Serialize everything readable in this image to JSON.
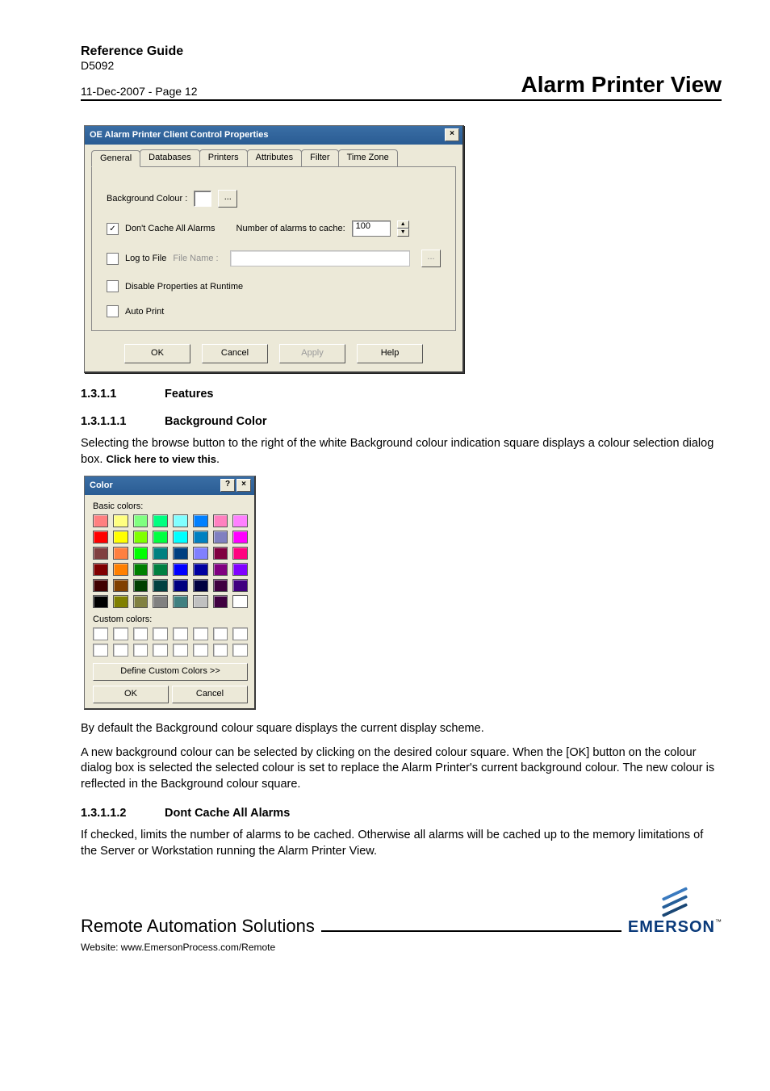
{
  "header": {
    "ref_guide": "Reference Guide",
    "doc_id": "D5092",
    "date_page": "11-Dec-2007 - Page 12",
    "view_title": "Alarm Printer View"
  },
  "dlg": {
    "title": "OE Alarm Printer Client Control Properties",
    "close": "×",
    "tabs": [
      "General",
      "Databases",
      "Printers",
      "Attributes",
      "Filter",
      "Time Zone"
    ],
    "bg_label": "Background Colour :",
    "browse": "...",
    "dont_cache": {
      "checked": true,
      "label": "Don't Cache All Alarms"
    },
    "num_label": "Number of alarms to cache:",
    "num_value": "100",
    "log_file": {
      "checked": false,
      "label": "Log to File",
      "file_label": "File Name :"
    },
    "disable_props": {
      "checked": false,
      "label": "Disable Properties at Runtime"
    },
    "auto_print": {
      "checked": false,
      "label": "Auto Print"
    },
    "buttons": {
      "ok": "OK",
      "cancel": "Cancel",
      "apply": "Apply",
      "help": "Help"
    }
  },
  "sections": {
    "s1_num": "1.3.1.1",
    "s1_title": "Features",
    "s2_num": "1.3.1.1.1",
    "s2_title": "Background Color",
    "s2_text_a": "Selecting the browse button to the right of the white Background colour indication square displays a colour selection dialog box. ",
    "s2_link": "Click here to view this",
    "s2_dot": ".",
    "s2_text_b": "By default the Background colour square displays the current display scheme.",
    "s2_text_c": "A new background colour can be selected by clicking on the desired colour square. When the [OK] button on the colour dialog box is selected the selected colour is set to replace the Alarm Printer's current background colour. The new colour is reflected in the Background colour square.",
    "s3_num": "1.3.1.1.2",
    "s3_title": "Dont Cache All Alarms",
    "s3_text": "If checked, limits the number of alarms to be cached. Otherwise all alarms will be cached up to the memory limitations of the Server or Workstation running the Alarm Printer View."
  },
  "color_dlg": {
    "title": "Color",
    "help": "?",
    "close": "×",
    "basic_label": "Basic colors:",
    "custom_label": "Custom colors:",
    "define": "Define Custom Colors >>",
    "ok": "OK",
    "cancel": "Cancel",
    "basic_colors": [
      [
        "#ff8080",
        "#ffff80",
        "#80ff80",
        "#00ff80",
        "#80ffff",
        "#0080ff",
        "#ff80c0",
        "#ff80ff"
      ],
      [
        "#ff0000",
        "#ffff00",
        "#80ff00",
        "#00ff40",
        "#00ffff",
        "#0080c0",
        "#8080c0",
        "#ff00ff"
      ],
      [
        "#804040",
        "#ff8040",
        "#00ff00",
        "#008080",
        "#004080",
        "#8080ff",
        "#800040",
        "#ff0080"
      ],
      [
        "#800000",
        "#ff8000",
        "#008000",
        "#008040",
        "#0000ff",
        "#0000a0",
        "#800080",
        "#8000ff"
      ],
      [
        "#400000",
        "#804000",
        "#004000",
        "#004040",
        "#000080",
        "#000040",
        "#400040",
        "#400080"
      ],
      [
        "#000000",
        "#808000",
        "#808040",
        "#808080",
        "#408080",
        "#c0c0c0",
        "#400040",
        "#ffffff"
      ]
    ]
  },
  "footer": {
    "company": "Remote Automation Solutions",
    "website": "Website:  www.EmersonProcess.com/Remote",
    "logo_word": "EMERSON",
    "logo_tm": "™"
  }
}
